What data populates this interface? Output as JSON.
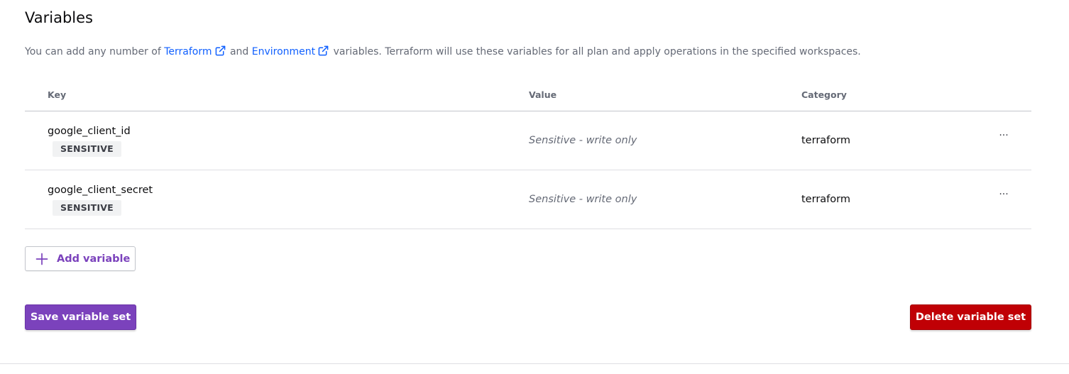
{
  "page": {
    "title": "Variables"
  },
  "intro": {
    "prefix": "You can add any number of ",
    "terraform_link": "Terraform",
    "middle": " and ",
    "environment_link": "Environment",
    "suffix": " variables. Terraform will use these variables for all plan and apply operations in the specified workspaces."
  },
  "table": {
    "headers": {
      "key": "Key",
      "value": "Value",
      "category": "Category"
    },
    "rows": [
      {
        "key": "google_client_id",
        "badge": "SENSITIVE",
        "value": "Sensitive - write only",
        "category": "terraform",
        "menu": "···"
      },
      {
        "key": "google_client_secret",
        "badge": "SENSITIVE",
        "value": "Sensitive - write only",
        "category": "terraform",
        "menu": "···"
      }
    ]
  },
  "actions": {
    "add_variable": "Add variable",
    "save": "Save variable set",
    "delete": "Delete variable set"
  },
  "colors": {
    "link": "#1060ff",
    "primary": "#7b42bc",
    "danger": "#c00005",
    "muted_text": "#656a76"
  },
  "icons": {
    "external_link": "external-link-icon",
    "plus": "plus-icon",
    "more": "more-horizontal-icon"
  }
}
